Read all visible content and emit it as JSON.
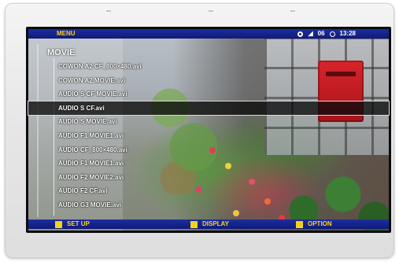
{
  "osd": {
    "menu_label": "MENU",
    "status": {
      "indicator_icon": "record-dot-icon",
      "volume_icon": "speaker-icon",
      "volume": "06",
      "clock_icon": "clock-icon",
      "time": "13:28"
    }
  },
  "browser": {
    "title": "MOVIE",
    "items": [
      {
        "label": "COWON A2 CF_800×480.avi"
      },
      {
        "label": "COWON A2 MOVIE.avi"
      },
      {
        "label": "AUDIO S CF MOVIE.avi"
      },
      {
        "label": "AUDIO S CF.avi",
        "selected": true
      },
      {
        "label": "AUDIO S MOVIE.avi"
      },
      {
        "label": "AUDIO F1 MOVIE1.avi"
      },
      {
        "label": "AUDIO  CF_800×480.avi"
      },
      {
        "label": "AUDIO F1 MOVIE1.avi"
      },
      {
        "label": "AUDIO F2 MOVIE2.avi"
      },
      {
        "label": "AUDIO F2 CF.avi"
      },
      {
        "label": "AUDIO G3 MOVIE.avi"
      }
    ]
  },
  "softkeys": {
    "left": "SET UP",
    "center": "DISPLAY",
    "right": "OPTION",
    "key_color": "#f3d21a"
  },
  "colors": {
    "bar_blue": "#1c2e9e",
    "label_yellow": "#ffd21f"
  }
}
